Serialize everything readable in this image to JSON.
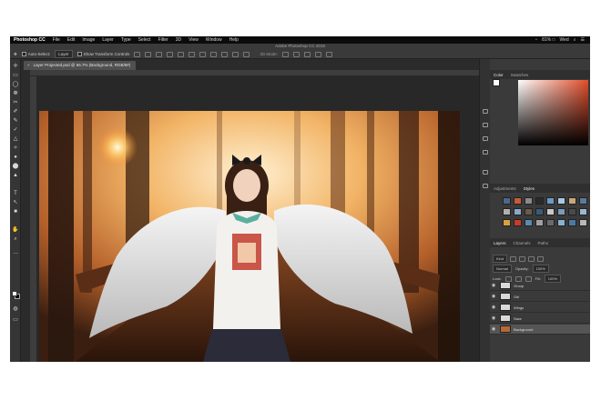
{
  "menubar": {
    "items": [
      "Photoshop CC",
      "File",
      "Edit",
      "Image",
      "Layer",
      "Type",
      "Select",
      "Filter",
      "3D",
      "View",
      "Window",
      "Help"
    ],
    "right_status": "81% □",
    "user_hint": "Wed"
  },
  "window": {
    "title": "Adobe Photoshop CC 2019"
  },
  "options": {
    "auto_select_label": "Auto-Select:",
    "auto_select_value": "Layer",
    "transform_controls_label": "Show Transform Controls",
    "mode_label": "3D Mode:"
  },
  "document_tab": {
    "label": "Layer Projected.psd @ 66.7% (Background, RGB/8#)",
    "close_glyph": "×"
  },
  "tools": [
    "✛",
    "▭",
    "◯",
    "❁",
    "✂",
    "✐",
    "✎",
    "✓",
    "△",
    "✧",
    "●",
    "⬤",
    "▲",
    "T",
    "↖",
    "■",
    "✋",
    "⌕",
    "…"
  ],
  "panels": {
    "color_tabs": [
      "Color",
      "Swatches"
    ],
    "adjustments_tabs": [
      "Adjustments",
      "Styles"
    ],
    "layers_tabs": [
      "Layers",
      "Channels",
      "Paths"
    ],
    "kind_label": "Kind",
    "blend_mode": "Normal",
    "opacity_label": "Opacity:",
    "opacity_value": "100%",
    "lock_label": "Lock:",
    "fill_label": "Fill:",
    "fill_value": "100%"
  },
  "layers": [
    {
      "name": "Group",
      "active": false
    },
    {
      "name": "Girl",
      "active": false
    },
    {
      "name": "Wings",
      "active": false
    },
    {
      "name": "Sara",
      "active": false
    },
    {
      "name": "Background",
      "active": true
    }
  ],
  "colors": {
    "accent": "#e04d2a",
    "panel_bg": "#3a3a3a",
    "chrome": "#2b2b2b"
  }
}
